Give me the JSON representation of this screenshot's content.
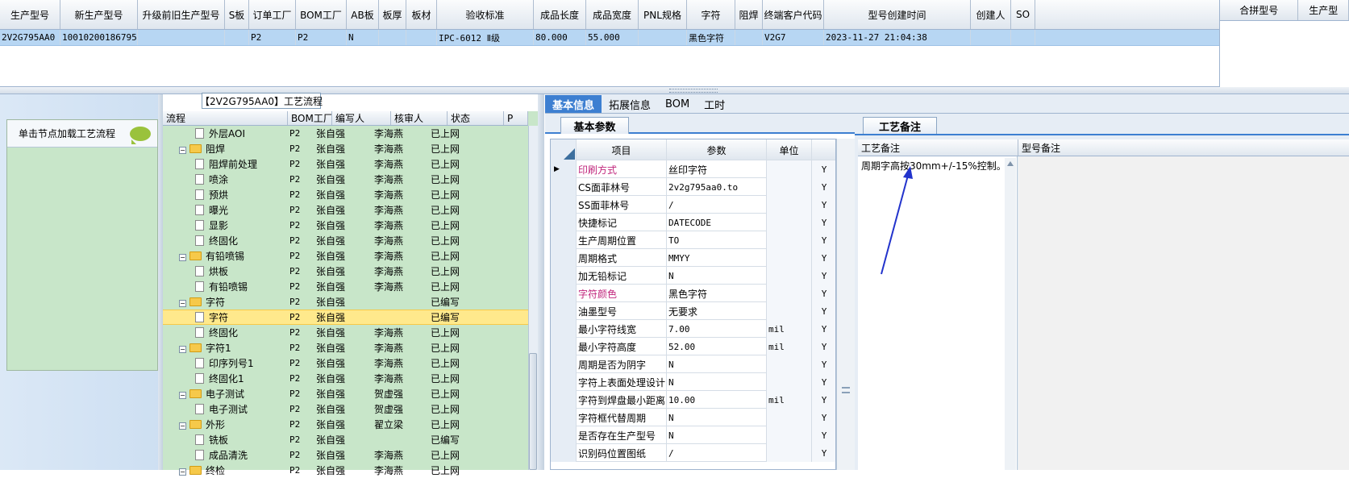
{
  "top_grid": {
    "columns": [
      "生产型号",
      "新生产型号",
      "升级前旧生产型号",
      "S板",
      "订单工厂",
      "BOM工厂",
      "AB板",
      "板厚",
      "板材",
      "验收标准",
      "成品长度",
      "成品宽度",
      "PNL规格",
      "字符",
      "阻焊",
      "终端客户代码",
      "型号创建时间",
      "创建人",
      "SO"
    ],
    "row": [
      "2V2G795AA0",
      "10010200186795",
      "",
      "",
      "P2",
      "P2",
      "N",
      "",
      "",
      "IPC-6012 Ⅱ级",
      "80.000",
      "55.000",
      "",
      "黑色字符",
      "",
      "V2G7",
      "2023-11-27 21:04:38",
      "",
      ""
    ]
  },
  "top_right": {
    "columns": [
      "合拼型号",
      "生产型"
    ]
  },
  "left_panel": {
    "load_label": "单击节点加载工艺流程"
  },
  "tree": {
    "title": "【2V2G795AA0】工艺流程",
    "columns": [
      "流程",
      "BOM工厂",
      "编写人",
      "核审人",
      "状态",
      "P"
    ],
    "rows": [
      {
        "name": "外层AOI",
        "bom": "P2",
        "writer": "张自强",
        "reviewer": "李海燕",
        "status": "已上网",
        "type": "doc"
      },
      {
        "name": "阻焊",
        "bom": "P2",
        "writer": "张自强",
        "reviewer": "李海燕",
        "status": "已上网",
        "type": "folder"
      },
      {
        "name": "阻焊前处理",
        "bom": "P2",
        "writer": "张自强",
        "reviewer": "李海燕",
        "status": "已上网",
        "type": "doc"
      },
      {
        "name": "喷涂",
        "bom": "P2",
        "writer": "张自强",
        "reviewer": "李海燕",
        "status": "已上网",
        "type": "doc"
      },
      {
        "name": "预烘",
        "bom": "P2",
        "writer": "张自强",
        "reviewer": "李海燕",
        "status": "已上网",
        "type": "doc"
      },
      {
        "name": "曝光",
        "bom": "P2",
        "writer": "张自强",
        "reviewer": "李海燕",
        "status": "已上网",
        "type": "doc"
      },
      {
        "name": "显影",
        "bom": "P2",
        "writer": "张自强",
        "reviewer": "李海燕",
        "status": "已上网",
        "type": "doc"
      },
      {
        "name": "终固化",
        "bom": "P2",
        "writer": "张自强",
        "reviewer": "李海燕",
        "status": "已上网",
        "type": "doc"
      },
      {
        "name": "有铅喷锡",
        "bom": "P2",
        "writer": "张自强",
        "reviewer": "李海燕",
        "status": "已上网",
        "type": "folder"
      },
      {
        "name": "烘板",
        "bom": "P2",
        "writer": "张自强",
        "reviewer": "李海燕",
        "status": "已上网",
        "type": "doc"
      },
      {
        "name": "有铅喷锡",
        "bom": "P2",
        "writer": "张自强",
        "reviewer": "李海燕",
        "status": "已上网",
        "type": "doc"
      },
      {
        "name": "字符",
        "bom": "P2",
        "writer": "张自强",
        "reviewer": "",
        "status": "已编写",
        "type": "folder"
      },
      {
        "name": "字符",
        "bom": "P2",
        "writer": "张自强",
        "reviewer": "",
        "status": "已编写",
        "type": "doc",
        "selected": true
      },
      {
        "name": "终固化",
        "bom": "P2",
        "writer": "张自强",
        "reviewer": "李海燕",
        "status": "已上网",
        "type": "doc"
      },
      {
        "name": "字符1",
        "bom": "P2",
        "writer": "张自强",
        "reviewer": "李海燕",
        "status": "已上网",
        "type": "folder"
      },
      {
        "name": "印序列号1",
        "bom": "P2",
        "writer": "张自强",
        "reviewer": "李海燕",
        "status": "已上网",
        "type": "doc"
      },
      {
        "name": "终固化1",
        "bom": "P2",
        "writer": "张自强",
        "reviewer": "李海燕",
        "status": "已上网",
        "type": "doc"
      },
      {
        "name": "电子测试",
        "bom": "P2",
        "writer": "张自强",
        "reviewer": "贺虚强",
        "status": "已上网",
        "type": "folder"
      },
      {
        "name": "电子测试",
        "bom": "P2",
        "writer": "张自强",
        "reviewer": "贺虚强",
        "status": "已上网",
        "type": "doc"
      },
      {
        "name": "外形",
        "bom": "P2",
        "writer": "张自强",
        "reviewer": "翟立梁",
        "status": "已上网",
        "type": "folder"
      },
      {
        "name": "铣板",
        "bom": "P2",
        "writer": "张自强",
        "reviewer": "",
        "status": "已编写",
        "type": "doc"
      },
      {
        "name": "成品清洗",
        "bom": "P2",
        "writer": "张自强",
        "reviewer": "李海燕",
        "status": "已上网",
        "type": "doc"
      },
      {
        "name": "终检",
        "bom": "P2",
        "writer": "张自强",
        "reviewer": "李海燕",
        "status": "已上网",
        "type": "folder"
      }
    ]
  },
  "tabs": [
    "基本信息",
    "拓展信息",
    "BOM",
    "工时"
  ],
  "params": {
    "tab_label": "基本参数",
    "columns": [
      "项目",
      "参数",
      "单位"
    ],
    "rows": [
      {
        "item": "印刷方式",
        "value": "丝印字符",
        "unit": "",
        "flag": "Y",
        "highlight": true
      },
      {
        "item": "CS面菲林号",
        "value": "2v2g795aa0.to",
        "unit": "",
        "flag": "Y"
      },
      {
        "item": "SS面菲林号",
        "value": "/",
        "unit": "",
        "flag": "Y"
      },
      {
        "item": "快捷标记",
        "value": "DATECODE",
        "unit": "",
        "flag": "Y"
      },
      {
        "item": "生产周期位置",
        "value": "TO",
        "unit": "",
        "flag": "Y"
      },
      {
        "item": "周期格式",
        "value": "MMYY",
        "unit": "",
        "flag": "Y"
      },
      {
        "item": "加无铅标记",
        "value": "N",
        "unit": "",
        "flag": "Y"
      },
      {
        "item": "字符颜色",
        "value": "黑色字符",
        "unit": "",
        "flag": "Y",
        "highlight": true
      },
      {
        "item": "油墨型号",
        "value": "无要求",
        "unit": "",
        "flag": "Y"
      },
      {
        "item": "最小字符线宽",
        "value": "7.00",
        "unit": "mil",
        "flag": "Y"
      },
      {
        "item": "最小字符高度",
        "value": "52.00",
        "unit": "mil",
        "flag": "Y"
      },
      {
        "item": "周期是否为阴字",
        "value": "N",
        "unit": "",
        "flag": "Y"
      },
      {
        "item": "字符上表面处理设计",
        "value": "N",
        "unit": "",
        "flag": "Y"
      },
      {
        "item": "字符到焊盘最小距离",
        "value": "10.00",
        "unit": "mil",
        "flag": "Y"
      },
      {
        "item": "字符框代替周期",
        "value": "N",
        "unit": "",
        "flag": "Y"
      },
      {
        "item": "是否存在生产型号",
        "value": "N",
        "unit": "",
        "flag": "Y"
      },
      {
        "item": "识别码位置图纸",
        "value": "/",
        "unit": "",
        "flag": "Y"
      }
    ]
  },
  "notes": {
    "tab_label": "工艺备注",
    "columns": [
      "工艺备注",
      "型号备注"
    ],
    "process_note": "周期字高按30mm+/-15%控制。"
  },
  "colors": {
    "accent": "#3d7fd1",
    "tree_bg": "#c8e6c9",
    "selected_row": "#b7d6f3",
    "arrow": "#2233cc",
    "highlight_text": "#c0267c"
  }
}
